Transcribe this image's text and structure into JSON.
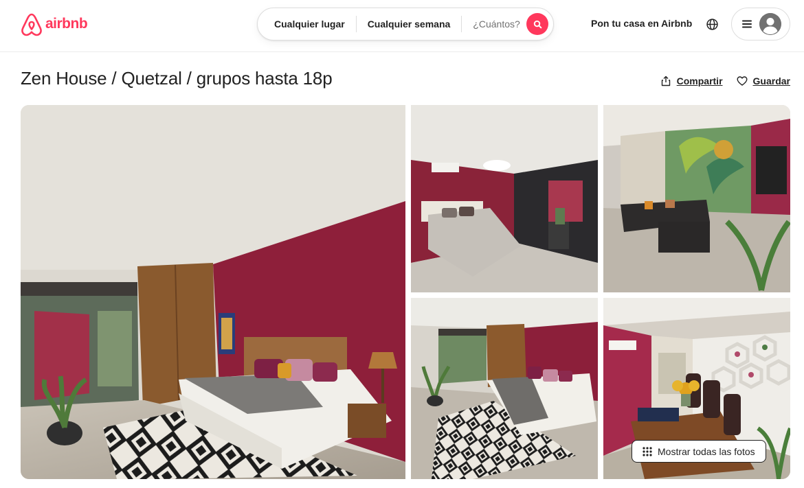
{
  "header": {
    "logo_text": "airbnb",
    "brand_color": "#ff385c",
    "search": {
      "where": "Cualquier lugar",
      "when": "Cualquier semana",
      "who": "¿Cuántos?",
      "button_icon": "search-icon"
    },
    "host_link": "Pon tu casa en Airbnb",
    "language_icon": "globe-icon",
    "menu_icon": "menu-icon",
    "avatar_icon": "user-avatar-icon"
  },
  "listing": {
    "title": "Zen House / Quetzal / grupos hasta 18p",
    "actions": {
      "share": "Compartir",
      "share_icon": "share-icon",
      "save": "Guardar",
      "save_icon": "heart-icon"
    }
  },
  "gallery": {
    "photos": [
      {
        "alt": "bedroom-with-red-wall-and-rug"
      },
      {
        "alt": "bedroom-with-ceiling-light"
      },
      {
        "alt": "living-room-with-mural"
      },
      {
        "alt": "bedroom-window-view"
      },
      {
        "alt": "dining-area-with-sunflowers"
      }
    ],
    "show_all_label": "Mostrar todas las fotos",
    "show_all_icon": "grid-dots-icon"
  }
}
